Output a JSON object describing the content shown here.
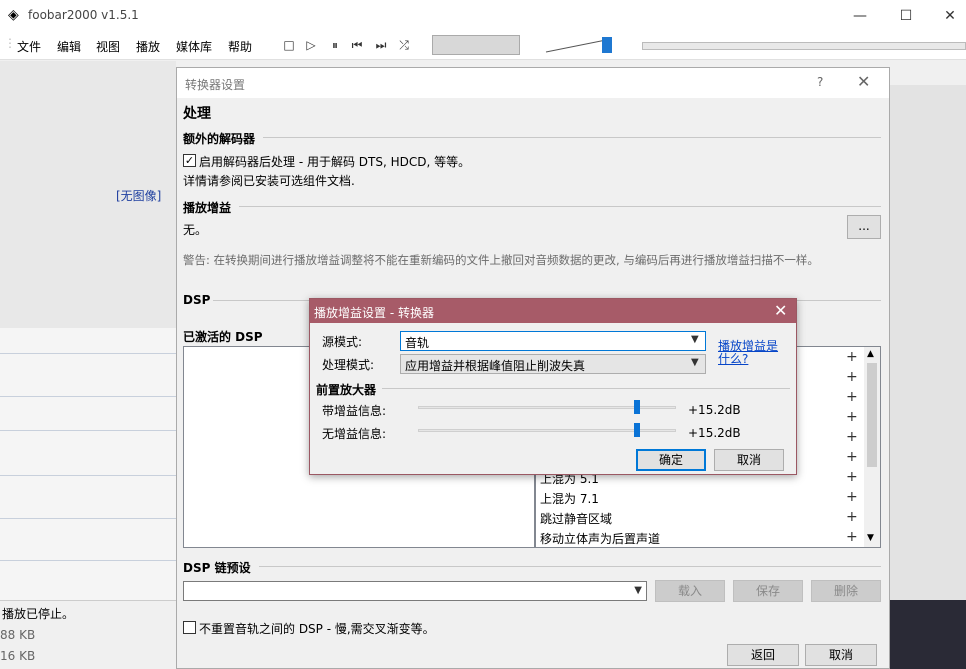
{
  "main": {
    "title": "foobar2000 v1.5.1",
    "menu": [
      "文件",
      "编辑",
      "视图",
      "播放",
      "媒体库",
      "帮助"
    ],
    "no_image": "[无图像]",
    "status": "播放已停止。",
    "sizes": [
      "88 KB",
      "16 KB"
    ]
  },
  "converter": {
    "title": "转换器设置",
    "help_icon": "?",
    "close_icon": "✕",
    "section_processing": "处理",
    "extra_decoder": "额外的解码器",
    "enable_postproc": "启用解码器后处理 - 用于解码 DTS, HDCD, 等等。",
    "enable_postproc_checked": true,
    "see_docs": "详情请参阅已安装可选组件文档.",
    "replaygain": "播放增益",
    "replaygain_value": "无。",
    "more_button": "...",
    "warning": "警告: 在转换期间进行播放增益调整将不能在重新编码的文件上撤回对音频数据的更改, 与编码后再进行播放增益扫描不一样。",
    "dsp": "DSP",
    "active_dsp": "已激活的 DSP",
    "available_dsp": [
      "上混为 5.1",
      "上混为 7.1",
      "跳过静音区域",
      "移动立体声为后置声道"
    ],
    "dsp_chain_presets": "DSP 链预设",
    "preset_buttons": [
      "载入",
      "保存",
      "删除"
    ],
    "no_reset": "不重置音轨之间的 DSP - 慢,需交叉渐变等。",
    "no_reset_checked": false,
    "back": "返回",
    "cancel": "取消"
  },
  "popup": {
    "title": "播放增益设置 - 转换器",
    "close_icon": "✕",
    "source_mode_label": "源模式:",
    "source_mode_value": "音轨",
    "processing_mode_label": "处理模式:",
    "processing_mode_value": "应用增益并根据峰值阻止削波失真",
    "what_is_link": "播放增益是什么?",
    "preamp": "前置放大器",
    "with_rg_label": "带增益信息:",
    "with_rg_value": "+15.2dB",
    "with_rg_level": 0.85,
    "without_rg_label": "无增益信息:",
    "without_rg_value": "+15.2dB",
    "without_rg_level": 0.85,
    "ok": "确定",
    "cancel": "取消"
  }
}
